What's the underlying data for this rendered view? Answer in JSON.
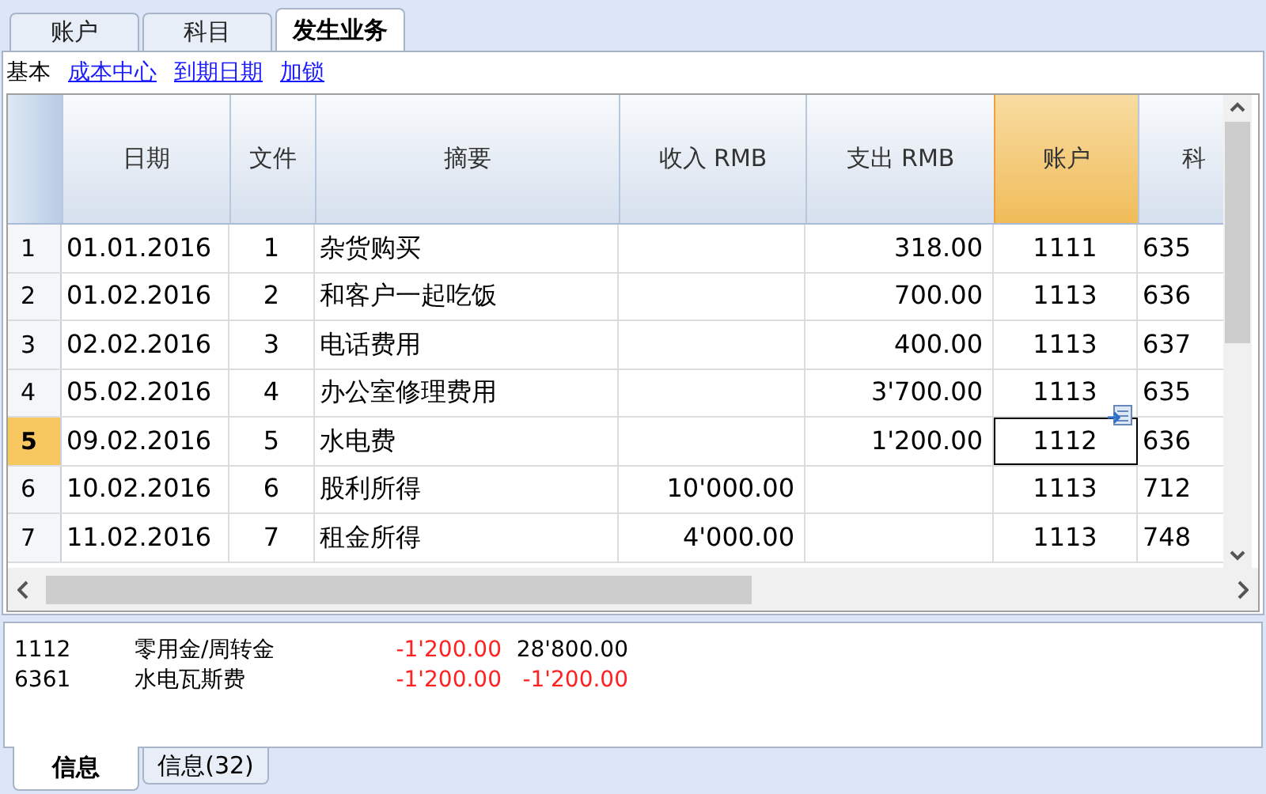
{
  "tabs": [
    {
      "label": "账户",
      "selected": false
    },
    {
      "label": "科目",
      "selected": false
    },
    {
      "label": "发生业务",
      "selected": true
    }
  ],
  "views": [
    {
      "label": "基本",
      "selected": true
    },
    {
      "label": "成本中心",
      "selected": false
    },
    {
      "label": "到期日期",
      "selected": false
    },
    {
      "label": "加锁",
      "selected": false
    }
  ],
  "table": {
    "columns": [
      {
        "label": "日期",
        "selected": false
      },
      {
        "label": "文件",
        "selected": false
      },
      {
        "label": "摘要",
        "selected": false
      },
      {
        "label": "收入 RMB",
        "selected": false
      },
      {
        "label": "支出 RMB",
        "selected": false
      },
      {
        "label": "账户",
        "selected": true
      },
      {
        "label": "科",
        "selected": false
      }
    ],
    "rows": [
      {
        "number": "1",
        "selected": false,
        "cells": [
          "01.01.2016",
          "1",
          "杂货购买",
          "",
          "318.00",
          "1111",
          "635"
        ]
      },
      {
        "number": "2",
        "selected": false,
        "cells": [
          "01.02.2016",
          "2",
          "和客户一起吃饭",
          "",
          "700.00",
          "1113",
          "636"
        ]
      },
      {
        "number": "3",
        "selected": false,
        "cells": [
          "02.02.2016",
          "3",
          "电话费用",
          "",
          "400.00",
          "1113",
          "637"
        ]
      },
      {
        "number": "4",
        "selected": false,
        "cells": [
          "05.02.2016",
          "4",
          "办公室修理费用",
          "",
          "3'700.00",
          "1113",
          "635"
        ]
      },
      {
        "number": "5",
        "selected": true,
        "cells": [
          "09.02.2016",
          "5",
          "水电费",
          "",
          "1'200.00",
          "1112",
          "636"
        ]
      },
      {
        "number": "6",
        "selected": false,
        "cells": [
          "10.02.2016",
          "6",
          "股利所得",
          "10'000.00",
          "",
          "1113",
          "712"
        ]
      },
      {
        "number": "7",
        "selected": false,
        "cells": [
          "11.02.2016",
          "7",
          "租金所得",
          "4'000.00",
          "",
          "1113",
          "748"
        ]
      }
    ]
  },
  "info": {
    "lines": [
      {
        "account": "1112",
        "name": "零用金/周转金",
        "amount": {
          "text": "-1'200.00",
          "negative": true
        },
        "balance": {
          "text": "28'800.00",
          "negative": false
        }
      },
      {
        "account": "6361",
        "name": "水电瓦斯费",
        "amount": {
          "text": "-1'200.00",
          "negative": true
        },
        "balance": {
          "text": "-1'200.00",
          "negative": true
        }
      }
    ],
    "tabs": [
      {
        "label": "信息",
        "selected": true
      },
      {
        "label": "信息(32)",
        "selected": false
      }
    ]
  }
}
